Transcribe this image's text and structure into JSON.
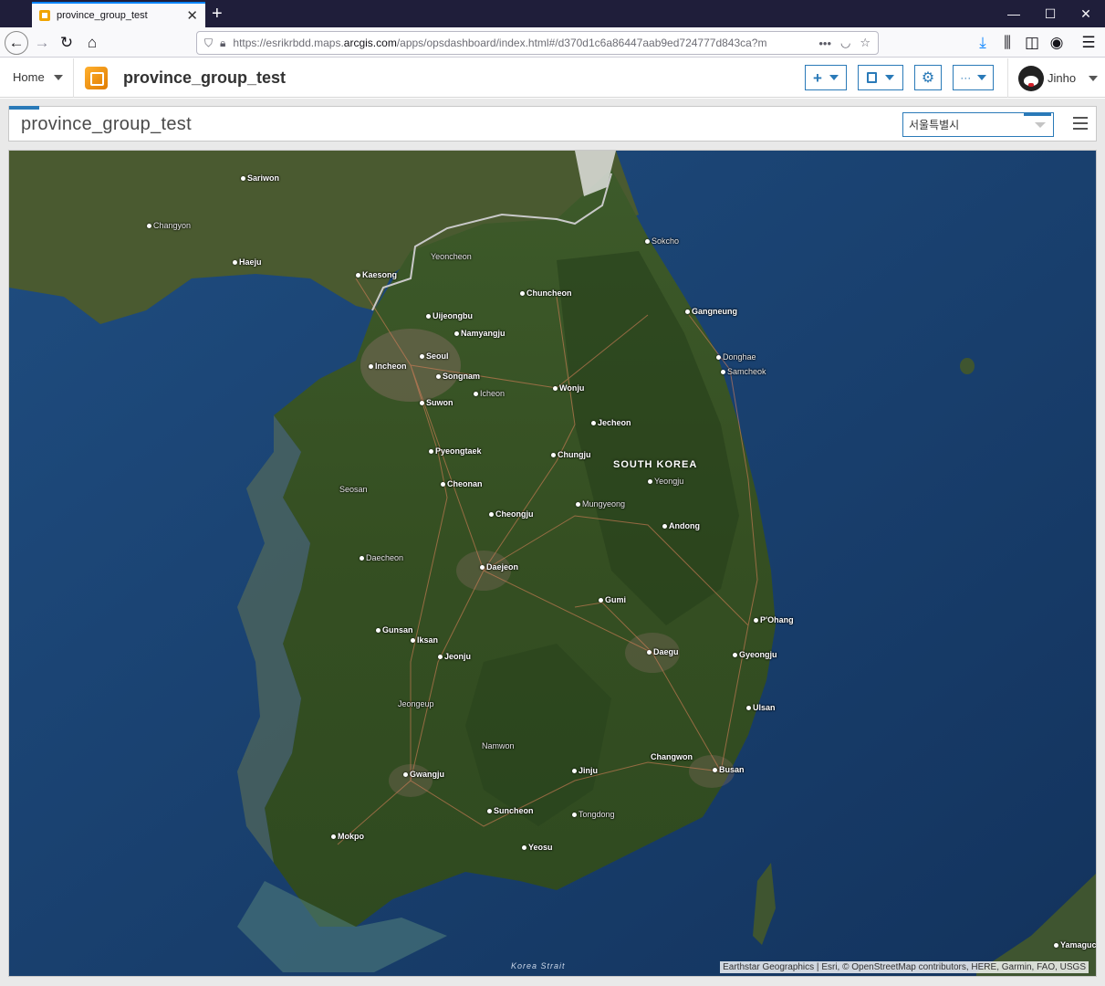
{
  "browser": {
    "tab_title": "province_group_test",
    "url_prefix": "https://esrikrbdd.maps.",
    "url_domain": "arcgis.com",
    "url_suffix": "/apps/opsdashboard/index.html#/d370d1c6a86447aab9ed724777d843ca?m",
    "new_tab_symbol": "+",
    "window_controls": [
      "—",
      "☐",
      "✕"
    ]
  },
  "app": {
    "home_label": "Home",
    "title": "province_group_test",
    "add_symbol": "+",
    "more_symbol": "···",
    "user_name": "Jinho"
  },
  "dashboard": {
    "title": "province_group_test",
    "selector_value": "서울특별시"
  },
  "map": {
    "country_label": "SOUTH KOREA",
    "strait_label": "Korea Strait",
    "attribution": "Earthstar Geographics | Esri, © OpenStreetMap contributors, HERE, Garmin, FAO, USGS",
    "cities": [
      {
        "name": "Sariwon",
        "major": true
      },
      {
        "name": "Changyon",
        "major": false
      },
      {
        "name": "Haeju",
        "major": true
      },
      {
        "name": "Kaesong",
        "major": true
      },
      {
        "name": "Yeoncheon",
        "major": false
      },
      {
        "name": "Sokcho",
        "major": false
      },
      {
        "name": "Chuncheon",
        "major": true
      },
      {
        "name": "Gangneung",
        "major": true
      },
      {
        "name": "Uijeongbu",
        "major": true
      },
      {
        "name": "Namyangju",
        "major": true
      },
      {
        "name": "Seoul",
        "major": true
      },
      {
        "name": "Incheon",
        "major": true
      },
      {
        "name": "Songnam",
        "major": true
      },
      {
        "name": "Donghae",
        "major": false
      },
      {
        "name": "Samcheok",
        "major": false
      },
      {
        "name": "Icheon",
        "major": false
      },
      {
        "name": "Wonju",
        "major": true
      },
      {
        "name": "Suwon",
        "major": true
      },
      {
        "name": "Jecheon",
        "major": true
      },
      {
        "name": "Pyeongtaek",
        "major": true
      },
      {
        "name": "Chungju",
        "major": true
      },
      {
        "name": "Yeongju",
        "major": false
      },
      {
        "name": "Cheonan",
        "major": true
      },
      {
        "name": "Seosan",
        "major": false
      },
      {
        "name": "Mungyeong",
        "major": false
      },
      {
        "name": "Cheongju",
        "major": true
      },
      {
        "name": "Andong",
        "major": true
      },
      {
        "name": "Daecheon",
        "major": false
      },
      {
        "name": "Daejeon",
        "major": true
      },
      {
        "name": "Gumi",
        "major": true
      },
      {
        "name": "P'Ohang",
        "major": true
      },
      {
        "name": "Gunsan",
        "major": true
      },
      {
        "name": "Iksan",
        "major": true
      },
      {
        "name": "Daegu",
        "major": true
      },
      {
        "name": "Gyeongju",
        "major": true
      },
      {
        "name": "Jeonju",
        "major": true
      },
      {
        "name": "Jeongeup",
        "major": false
      },
      {
        "name": "Ulsan",
        "major": true
      },
      {
        "name": "Namwon",
        "major": false
      },
      {
        "name": "Changwon",
        "major": true
      },
      {
        "name": "Jinju",
        "major": true
      },
      {
        "name": "Busan",
        "major": true
      },
      {
        "name": "Gwangju",
        "major": true
      },
      {
        "name": "Suncheon",
        "major": true
      },
      {
        "name": "Tongdong",
        "major": false
      },
      {
        "name": "Mokpo",
        "major": true
      },
      {
        "name": "Yeosu",
        "major": true
      },
      {
        "name": "Yamaguchi",
        "major": true
      }
    ]
  }
}
